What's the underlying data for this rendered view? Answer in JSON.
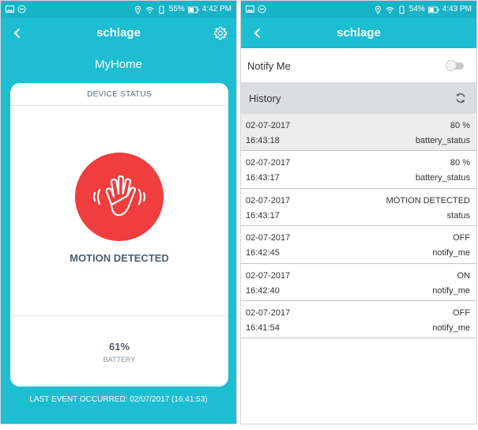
{
  "left_screen": {
    "status_bar": {
      "battery": "55%",
      "time": "4:42 PM"
    },
    "app_bar": {
      "title": "schlage"
    },
    "home_title": "MyHome",
    "card": {
      "header": "DEVICE STATUS",
      "motion_label": "MOTION DETECTED",
      "battery_value": "61%",
      "battery_label": "BATTERY"
    },
    "last_event": "LAST EVENT OCCURRED: 02/07/2017 (16:41:53)"
  },
  "right_screen": {
    "status_bar": {
      "battery": "54%",
      "time": "4:43 PM"
    },
    "app_bar": {
      "title": "schlage"
    },
    "notify": {
      "label": "Notify Me",
      "enabled": false
    },
    "history": {
      "label": "History",
      "rows": [
        {
          "date": "02-07-2017",
          "time": "16:43:18",
          "value": "80 %",
          "type": "battery_status",
          "selected": true
        },
        {
          "date": "02-07-2017",
          "time": "16:43:17",
          "value": "80 %",
          "type": "battery_status"
        },
        {
          "date": "02-07-2017",
          "time": "16:43:17",
          "value": "MOTION DETECTED",
          "type": "status"
        },
        {
          "date": "02-07-2017",
          "time": "16:42:45",
          "value": "OFF",
          "type": "notify_me"
        },
        {
          "date": "02-07-2017",
          "time": "16:42:40",
          "value": "ON",
          "type": "notify_me"
        },
        {
          "date": "02-07-2017",
          "time": "16:41:54",
          "value": "OFF",
          "type": "notify_me"
        }
      ]
    }
  },
  "colors": {
    "teal": "#1dbdd2",
    "status_bar": "#19b3c8",
    "motion_red": "#f03d3d",
    "history_header": "#dcdde0"
  },
  "icons": {
    "back": "chevron-left-icon",
    "settings": "gear-icon",
    "motion": "hand-wave-icon",
    "refresh": "refresh-icon"
  }
}
